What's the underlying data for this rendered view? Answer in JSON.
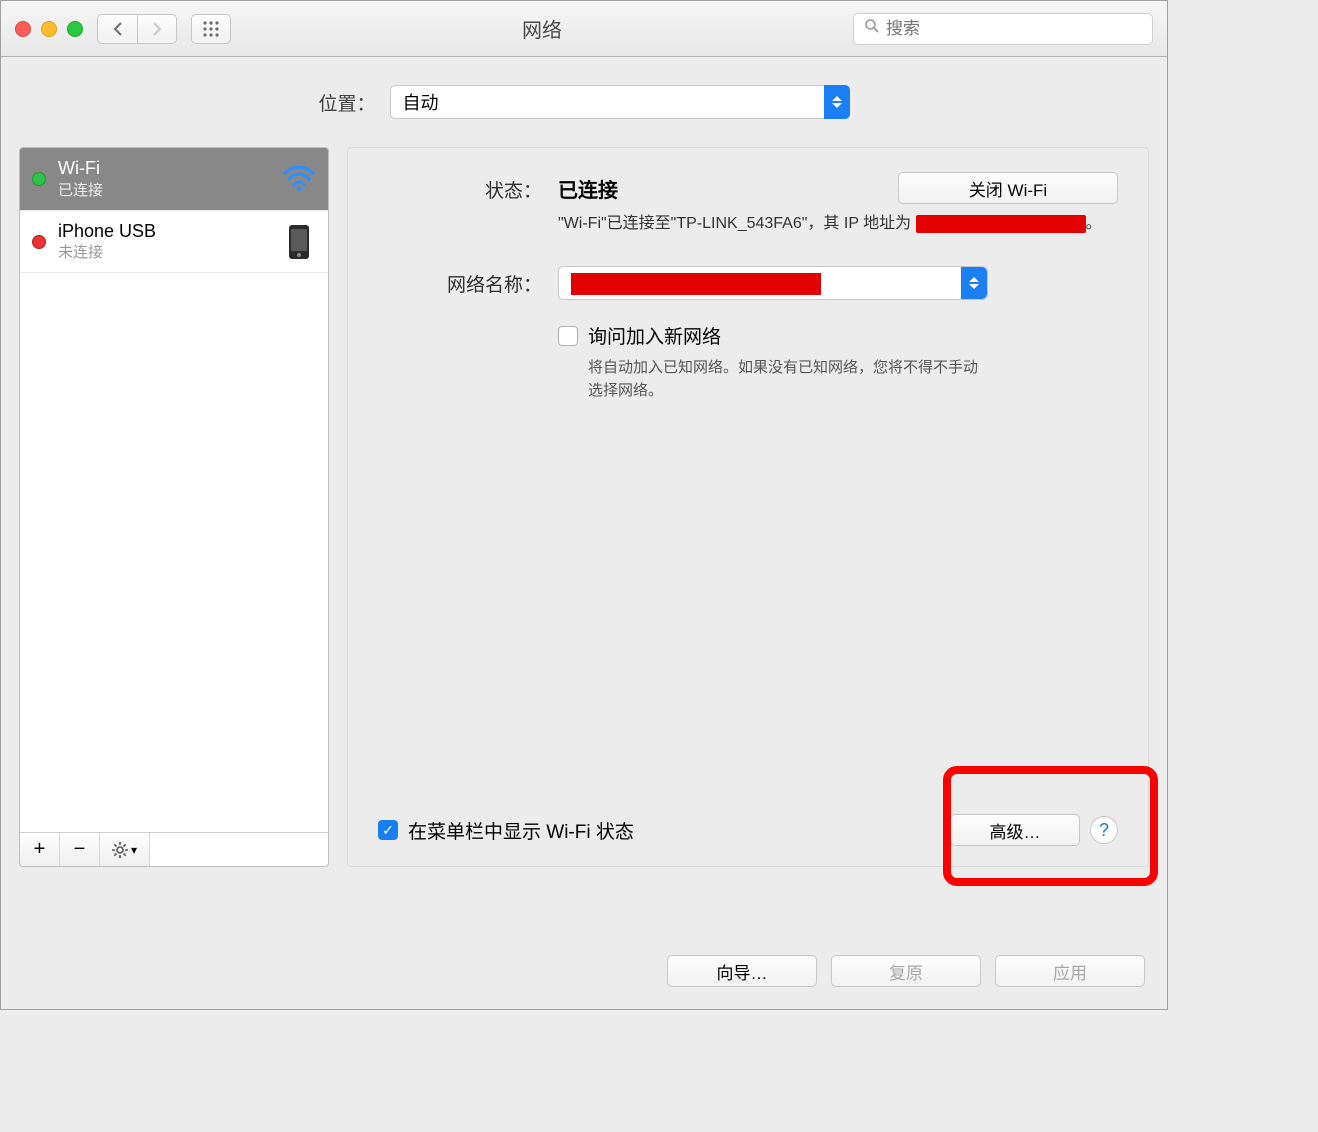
{
  "window": {
    "title": "网络"
  },
  "search": {
    "placeholder": "搜索"
  },
  "location": {
    "label": "位置：",
    "value": "自动"
  },
  "services": [
    {
      "name": "Wi-Fi",
      "status": "已连接",
      "dot": "#2fc24a",
      "icon": "wifi",
      "active": true
    },
    {
      "name": "iPhone USB",
      "status": "未连接",
      "dot": "#e83434",
      "icon": "iphone",
      "active": false
    }
  ],
  "detail": {
    "status_label": "状态：",
    "status_value": "已连接",
    "wifi_toggle": "关闭 Wi-Fi",
    "status_note_pre": "\"Wi-Fi\"已连接至\"TP-LINK_543FA6\"，其 IP 地址为",
    "network_label": "网络名称：",
    "ask_join_label": "询问加入新网络",
    "ask_join_hint": "将自动加入已知网络。如果没有已知网络，您将不得不手动选择网络。",
    "show_status_label": "在菜单栏中显示 Wi-Fi 状态",
    "advanced_label": "高级…"
  },
  "footer": {
    "assist": "向导…",
    "revert": "复原",
    "apply": "应用"
  }
}
